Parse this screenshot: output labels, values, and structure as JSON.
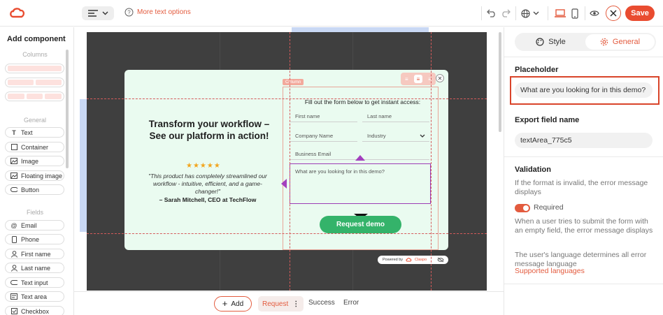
{
  "toolbar": {
    "help_text": "More text options",
    "save_label": "Save"
  },
  "left_panel": {
    "title": "Add component",
    "columns_heading": "Columns",
    "general_heading": "General",
    "fields_heading": "Fields",
    "general_items": [
      {
        "label": "Text",
        "icon": "text-icon"
      },
      {
        "label": "Container",
        "icon": "container-icon"
      },
      {
        "label": "Image",
        "icon": "image-icon"
      },
      {
        "label": "Floating image",
        "icon": "floating-image-icon"
      },
      {
        "label": "Button",
        "icon": "button-icon"
      }
    ],
    "field_items": [
      {
        "label": "Email",
        "icon": "at-icon"
      },
      {
        "label": "Phone",
        "icon": "phone-icon"
      },
      {
        "label": "First name",
        "icon": "person-icon"
      },
      {
        "label": "Last name",
        "icon": "person-icon"
      },
      {
        "label": "Text input",
        "icon": "text-input-icon"
      },
      {
        "label": "Text area",
        "icon": "text-area-icon"
      },
      {
        "label": "Checkbox",
        "icon": "checkbox-icon"
      }
    ]
  },
  "popup": {
    "heading": "Transform your workflow – See our platform in action!",
    "stars": "★★★★★",
    "quote": "\"This product has completely streamlined our workflow - intuitive, efficient, and a game-changer!\"",
    "author": "– Sarah Mitchell, CEO at TechFlow",
    "column_tag": "Column",
    "form_intro": "Fill out the form below to get instant access:",
    "first_name": "First name",
    "last_name": "Last name",
    "company_name": "Company Name",
    "industry": "Industry",
    "business_email": "Business Email",
    "textarea_placeholder": "What are you looking for in this demo?",
    "submit_label": "Request demo",
    "powered_by": "Powered by",
    "brand": "Claspo"
  },
  "bottom_bar": {
    "add_label": "Add",
    "tabs": [
      "Request",
      "Success",
      "Error"
    ]
  },
  "right_panel": {
    "tabs": {
      "style": "Style",
      "general": "General"
    },
    "placeholder_label": "Placeholder",
    "placeholder_value": "What are you looking for in this demo?",
    "export_label": "Export field name",
    "export_value": "textArea_775c5",
    "validation_label": "Validation",
    "validation_desc": "If the format is invalid, the error message displays",
    "required_label": "Required",
    "required_desc": "When a user tries to submit the form with an empty field, the error message displays",
    "language_desc": "The user's language determines all error message language",
    "languages_link": "Supported languages"
  },
  "colors": {
    "accent": "#e94c30",
    "submit": "#34b36a",
    "popup_bg": "#eafbf0",
    "selection": "#a33fbe"
  }
}
